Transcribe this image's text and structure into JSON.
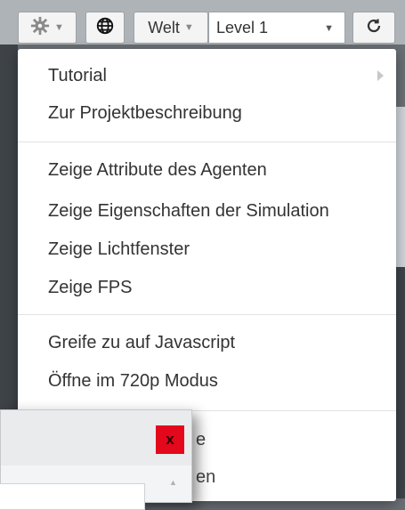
{
  "toolbar": {
    "world_label": "Welt",
    "level_value": "Level 1"
  },
  "menu": {
    "items": [
      {
        "label": "Tutorial",
        "has_submenu": true
      },
      {
        "label": "Zur Projektbeschreibung"
      },
      {
        "label": "Zeige Attribute des Agenten"
      },
      {
        "label": "Zeige Eigenschaften der Simulation"
      },
      {
        "label": "Zeige Lichtfenster"
      },
      {
        "label": "Zeige FPS"
      },
      {
        "label": "Greife zu auf Javascript"
      },
      {
        "label": "Öffne im 720p Modus"
      }
    ],
    "partially_hidden": [
      "e",
      "en"
    ]
  },
  "dialog": {
    "close_label": "x"
  },
  "colors": {
    "close_button": "#e3081b",
    "menu_text": "#333333"
  }
}
